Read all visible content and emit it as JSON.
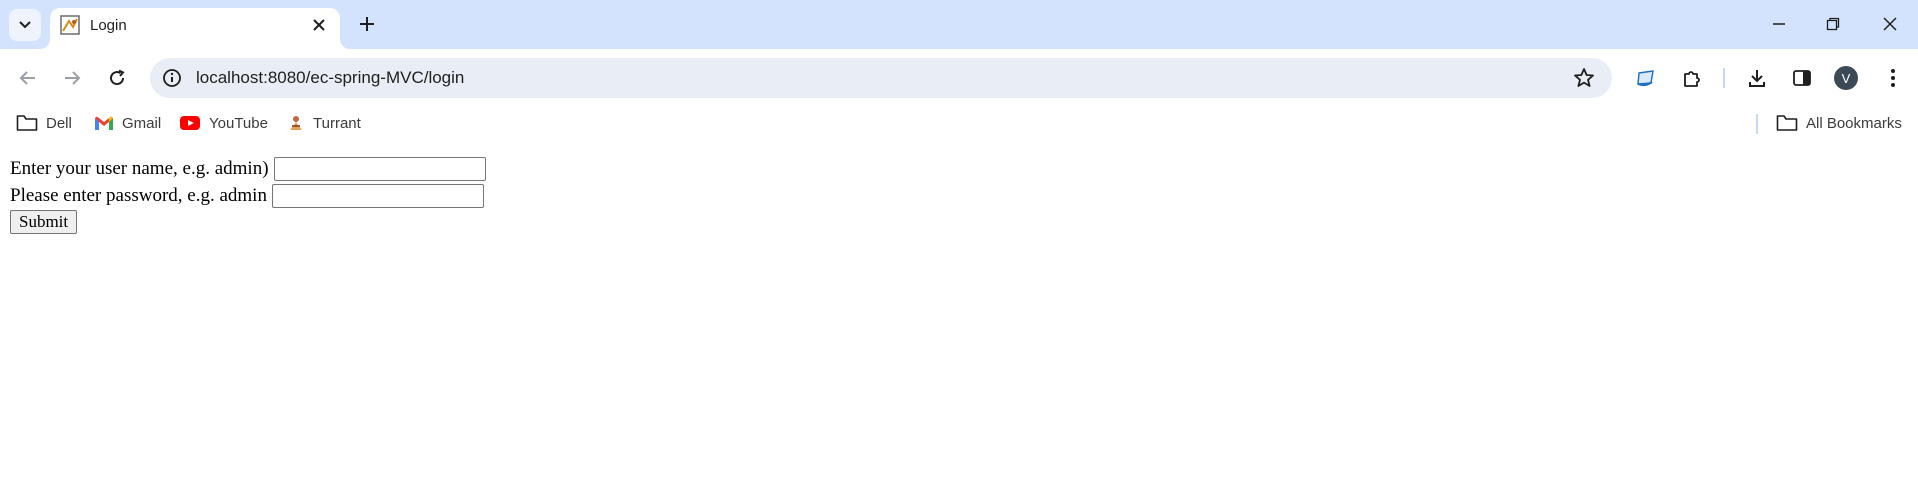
{
  "browser": {
    "tab": {
      "title": "Login"
    },
    "address": {
      "url": "localhost:8080/ec-spring-MVC/login"
    },
    "profile_initial": "V",
    "bookmarks": [
      {
        "label": "Dell",
        "icon": "folder-icon"
      },
      {
        "label": "Gmail",
        "icon": "gmail-icon"
      },
      {
        "label": "YouTube",
        "icon": "youtube-icon"
      },
      {
        "label": "Turrant",
        "icon": "turrant-icon"
      }
    ],
    "all_bookmarks_label": "All Bookmarks"
  },
  "form": {
    "username_label": "Enter your user name, e.g. admin)",
    "username_value": "",
    "password_label": "Please enter password, e.g. admin",
    "password_value": "",
    "submit_label": "Submit"
  }
}
